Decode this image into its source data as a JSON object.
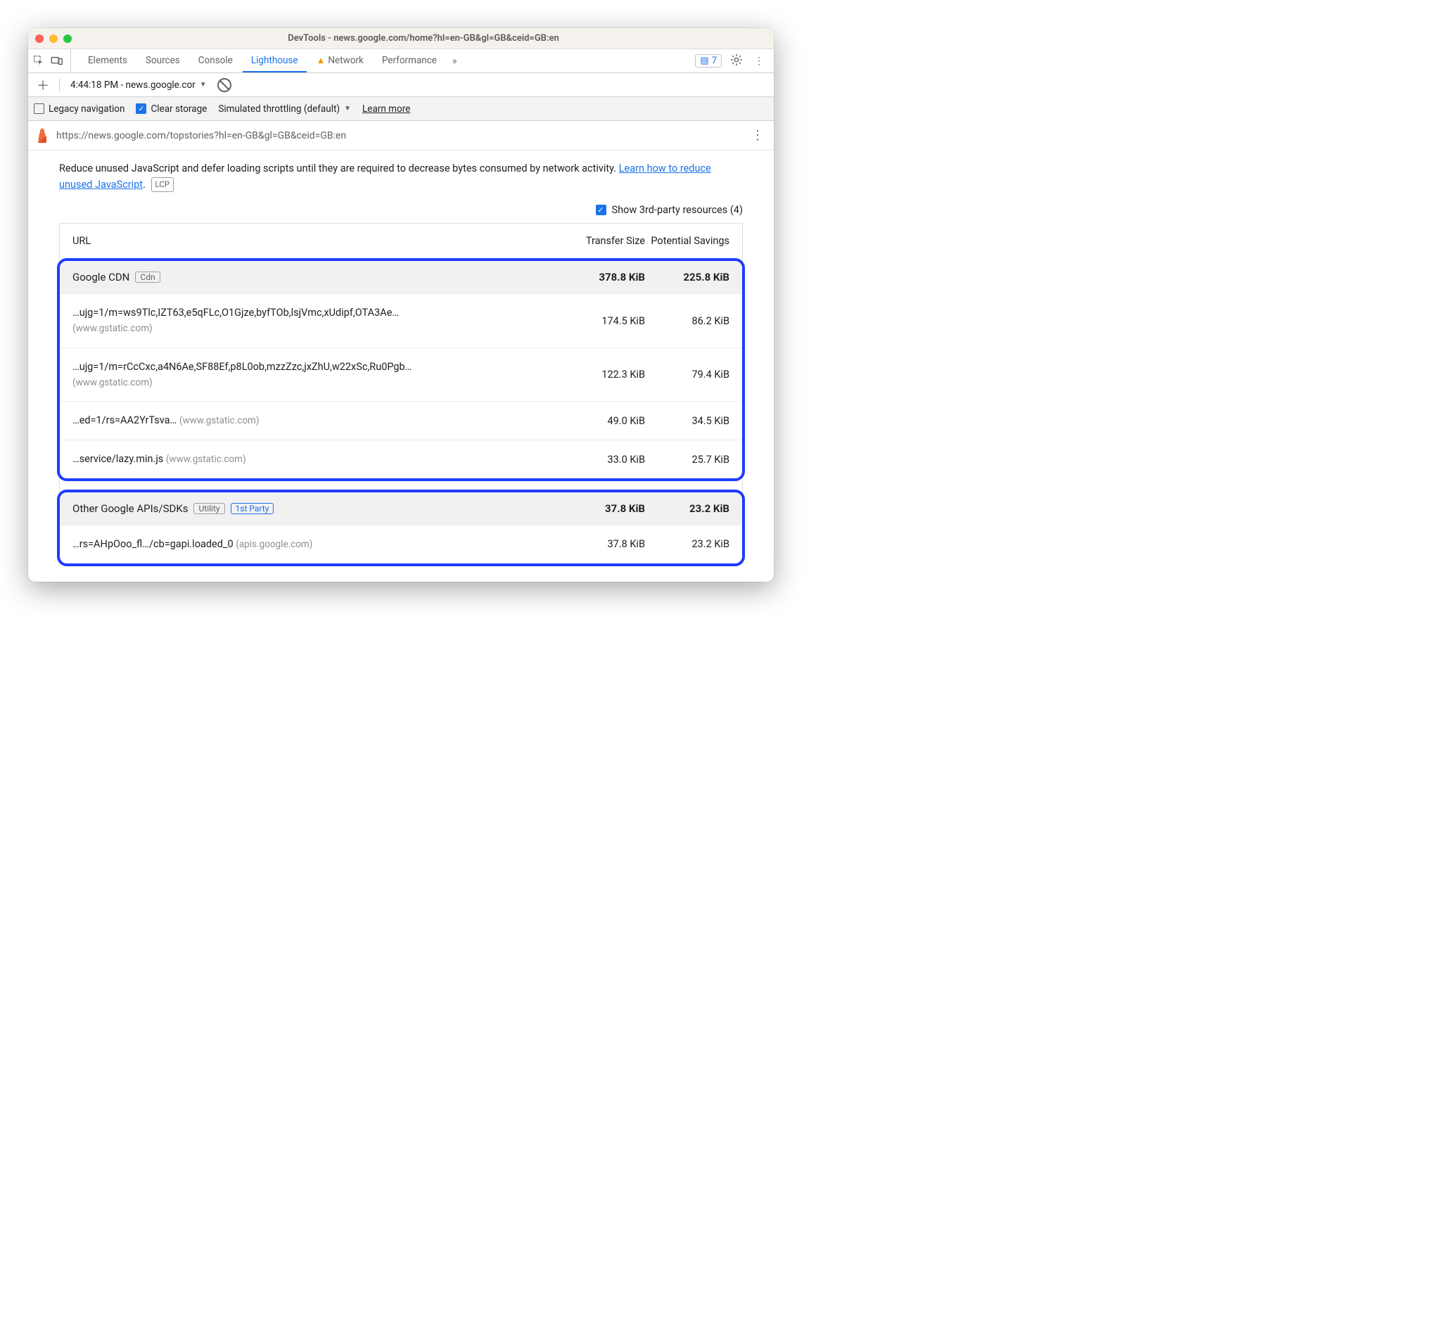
{
  "window": {
    "title": "DevTools - news.google.com/home?hl=en-GB&gl=GB&ceid=GB:en"
  },
  "tabs": {
    "items": [
      "Elements",
      "Sources",
      "Console",
      "Lighthouse",
      "Network",
      "Performance"
    ],
    "active_index": 3,
    "network_warning": true,
    "messages_count": "7"
  },
  "subbar": {
    "report_label": "4:44:18 PM - news.google.cor"
  },
  "options": {
    "legacy_nav_label": "Legacy navigation",
    "legacy_nav_checked": false,
    "clear_storage_label": "Clear storage",
    "clear_storage_checked": true,
    "throttling_label": "Simulated throttling (default)",
    "learn_more": "Learn more"
  },
  "urlbar": {
    "url": "https://news.google.com/topstories?hl=en-GB&gl=GB&ceid=GB:en"
  },
  "audit": {
    "desc_prefix": "Reduce unused JavaScript and defer loading scripts until they are required to decrease bytes consumed by network activity. ",
    "desc_link": "Learn how to reduce unused JavaScript",
    "desc_suffix": ".",
    "lcp_tag": "LCP",
    "show3p_label": "Show 3rd-party resources (4)",
    "show3p_checked": true,
    "columns": {
      "url": "URL",
      "transfer": "Transfer Size",
      "savings": "Potential Savings"
    },
    "groups": [
      {
        "name": "Google CDN",
        "tags": [
          {
            "text": "Cdn",
            "style": "gray"
          }
        ],
        "transfer": "378.8 KiB",
        "savings": "225.8 KiB",
        "rows": [
          {
            "url": "…ujg=1/m=ws9Tlc,IZT63,e5qFLc,O1Gjze,byfTOb,lsjVmc,xUdipf,OTA3Ae…",
            "host": "(www.gstatic.com)",
            "host_inline": false,
            "transfer": "174.5 KiB",
            "savings": "86.2 KiB"
          },
          {
            "url": "…ujg=1/m=rCcCxc,a4N6Ae,SF88Ef,p8L0ob,mzzZzc,jxZhU,w22xSc,Ru0Pgb…",
            "host": "(www.gstatic.com)",
            "host_inline": false,
            "transfer": "122.3 KiB",
            "savings": "79.4 KiB"
          },
          {
            "url": "…ed=1/rs=AA2YrTsva…",
            "host": "(www.gstatic.com)",
            "host_inline": true,
            "transfer": "49.0 KiB",
            "savings": "34.5 KiB"
          },
          {
            "url": "…service/lazy.min.js",
            "host": "(www.gstatic.com)",
            "host_inline": true,
            "transfer": "33.0 KiB",
            "savings": "25.7 KiB"
          }
        ]
      },
      {
        "name": "Other Google APIs/SDKs",
        "tags": [
          {
            "text": "Utility",
            "style": "gray"
          },
          {
            "text": "1st Party",
            "style": "blue"
          }
        ],
        "transfer": "37.8 KiB",
        "savings": "23.2 KiB",
        "rows": [
          {
            "url": "…rs=AHpOoo_fl…/cb=gapi.loaded_0",
            "host": "(apis.google.com)",
            "host_inline": true,
            "transfer": "37.8 KiB",
            "savings": "23.2 KiB"
          }
        ]
      }
    ]
  }
}
